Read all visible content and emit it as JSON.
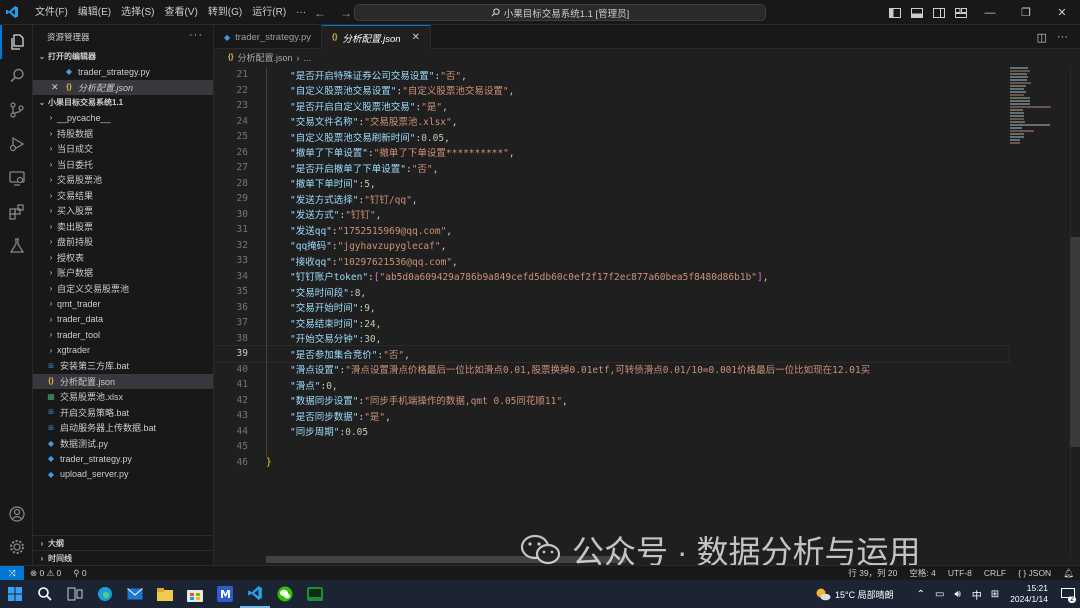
{
  "titlebar": {
    "menu": [
      "文件(F)",
      "编辑(E)",
      "选择(S)",
      "查看(V)",
      "转到(G)",
      "运行(R)",
      "···"
    ],
    "search_text": "小果目标交易系统1.1 [管理员]"
  },
  "sidebar": {
    "header": "资源管理器",
    "more": "···",
    "open_editors_label": "打开的编辑器",
    "open_editors": [
      {
        "name": "trader_strategy.py",
        "type": "py"
      },
      {
        "name": "分析配置.json",
        "type": "json",
        "close": "✕"
      }
    ],
    "project_label": "小果目标交易系统1.1",
    "folders": [
      "__pycache__",
      "持股数据",
      "当日成交",
      "当日委托",
      "交易股票池",
      "交易结果",
      "买入股票",
      "卖出股票",
      "盘前持股",
      "授权表",
      "账户数据",
      "自定义交易股票池",
      "qmt_trader",
      "trader_data",
      "trader_tool",
      "xgtrader"
    ],
    "files": [
      {
        "name": "安装第三方库.bat",
        "type": "bat"
      },
      {
        "name": "分析配置.json",
        "type": "json"
      },
      {
        "name": "交易股票池.xlsx",
        "type": "xls"
      },
      {
        "name": "开启交易策略.bat",
        "type": "bat"
      },
      {
        "name": "启动服务器上传数据.bat",
        "type": "bat"
      },
      {
        "name": "数据测试.py",
        "type": "py"
      },
      {
        "name": "trader_strategy.py",
        "type": "py"
      },
      {
        "name": "upload_server.py",
        "type": "py"
      }
    ],
    "outline_label": "大纲",
    "timeline_label": "时间线"
  },
  "editor": {
    "tabs": [
      {
        "name": "trader_strategy.py"
      },
      {
        "name": "分析配置.json"
      }
    ],
    "breadcrumb_file": "分析配置.json",
    "breadcrumb_more": "...",
    "lines": [
      {
        "num": "21",
        "key": "\"是否开启特殊证券公司交易设置\"",
        "val": "\"否\"",
        "kind": "s",
        "tail": ","
      },
      {
        "num": "22",
        "key": "\"自定义股票池交易设置\"",
        "val": "\"自定义股票池交易设置\"",
        "kind": "s",
        "tail": ","
      },
      {
        "num": "23",
        "key": "\"是否开启自定义股票池交易\"",
        "val": "\"是\"",
        "kind": "s",
        "tail": ","
      },
      {
        "num": "24",
        "key": "\"交易文件名称\"",
        "val": "\"交易股票池.xlsx\"",
        "kind": "s",
        "tail": ","
      },
      {
        "num": "25",
        "key": "\"自定义股票池交易刷新时间\"",
        "val": "0.05",
        "kind": "n",
        "tail": ","
      },
      {
        "num": "26",
        "key": "\"撤单了下单设置\"",
        "val": "\"撤单了下单设置**********\"",
        "kind": "s",
        "tail": ","
      },
      {
        "num": "27",
        "key": "\"是否开启撤单了下单设置\"",
        "val": "\"否\"",
        "kind": "s",
        "tail": ","
      },
      {
        "num": "28",
        "key": "\"撤单下单时间\"",
        "val": "5",
        "kind": "n",
        "tail": ","
      },
      {
        "num": "29",
        "key": "\"发送方式选择\"",
        "val": "\"钉钉/qq\"",
        "kind": "s",
        "tail": ","
      },
      {
        "num": "30",
        "key": "\"发送方式\"",
        "val": "\"钉钉\"",
        "kind": "s",
        "tail": ","
      },
      {
        "num": "31",
        "key": "\"发送qq\"",
        "val": "\"1752515969@qq.com\"",
        "kind": "s",
        "tail": ","
      },
      {
        "num": "32",
        "key": "\"qq掩码\"",
        "val": "\"jgyhavzupyglecaf\"",
        "kind": "s",
        "tail": ","
      },
      {
        "num": "33",
        "key": "\"接收qq\"",
        "val": "\"10297621536@qq.com\"",
        "kind": "s",
        "tail": ","
      },
      {
        "num": "34",
        "key": "\"钉钉账户token\"",
        "val": "\"ab5d0a609429a786b9a849cefd5db60c0ef2f17f2ec877a60bea5f8480d86b1b\"",
        "kind": "arr",
        "tail": ","
      },
      {
        "num": "35",
        "key": "\"交易时间段\"",
        "val": "8",
        "kind": "n",
        "tail": ","
      },
      {
        "num": "36",
        "key": "\"交易开始时间\"",
        "val": "9",
        "kind": "n",
        "tail": ","
      },
      {
        "num": "37",
        "key": "\"交易结束时间\"",
        "val": "24",
        "kind": "n",
        "tail": ","
      },
      {
        "num": "38",
        "key": "\"开始交易分钟\"",
        "val": "30",
        "kind": "n",
        "tail": ","
      },
      {
        "num": "39",
        "key": "\"是否参加集合竞价\"",
        "val": "\"否\"",
        "kind": "s",
        "tail": ","
      },
      {
        "num": "40",
        "key": "\"滑点设置\"",
        "val": "\"滑点设置滑点价格最后一位比如滑点0.01,股票换掉0.01etf,可转债滑点0.01/10=0.001价格最后一位比如现在12.01买",
        "kind": "slip",
        "tail": ""
      },
      {
        "num": "41",
        "key": "\"滑点\"",
        "val": "0",
        "kind": "n",
        "tail": ","
      },
      {
        "num": "42",
        "key": "\"数据同步设置\"",
        "val": "\"同步手机端操作的数据,qmt 0.05同花顺11\"",
        "kind": "s",
        "tail": ","
      },
      {
        "num": "43",
        "key": "\"是否同步数据\"",
        "val": "\"是\"",
        "kind": "s",
        "tail": ","
      },
      {
        "num": "44",
        "key": "\"同步周期\"",
        "val": "0.05",
        "kind": "n",
        "tail": ""
      },
      {
        "num": "45",
        "key": "",
        "val": "",
        "kind": "empty",
        "tail": ""
      },
      {
        "num": "46",
        "key": "}",
        "val": "",
        "kind": "brace",
        "tail": ""
      }
    ],
    "current_line": "39"
  },
  "watermark": "公众号 · 数据分析与运用",
  "statusbar": {
    "errors": "⊗ 0 ⚠ 0",
    "ports": "⚲ 0",
    "position": "行 39，列 20",
    "spaces": "空格: 4",
    "encoding": "UTF-8",
    "eol": "CRLF",
    "language": "{ } JSON"
  },
  "taskbar": {
    "weather": "15°C 局部晴朗",
    "lang": "中",
    "time": "15:21",
    "date": "2024/1/14",
    "notif_count": "2"
  }
}
